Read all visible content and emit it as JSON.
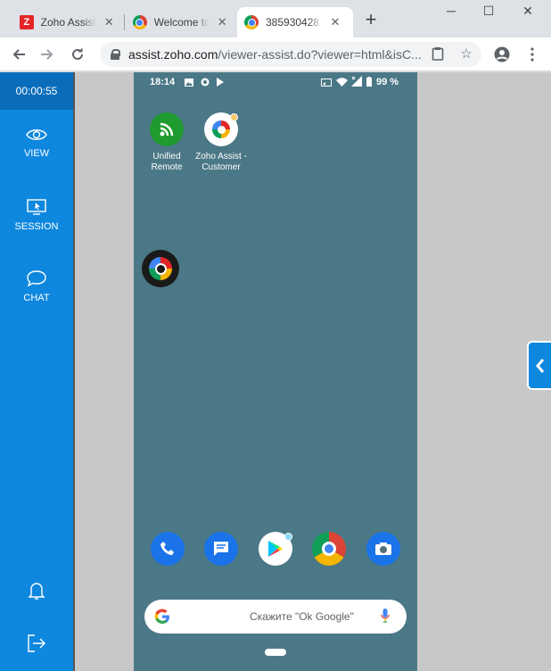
{
  "browser": {
    "tabs": [
      {
        "title": "Zoho Assist",
        "close": "✕"
      },
      {
        "title": "Welcome to",
        "close": "✕"
      },
      {
        "title": "385930428",
        "close": "✕"
      }
    ],
    "new_tab": "+",
    "window": {
      "minimize": "─",
      "maximize": "☐",
      "close": "✕"
    },
    "url": {
      "host": "assist.zoho.com",
      "path": "/viewer-assist.do?viewer=html&isC..."
    }
  },
  "sidebar": {
    "timer": "00:00:55",
    "items": [
      {
        "label": "VIEW",
        "icon": "eye-icon"
      },
      {
        "label": "SESSION",
        "icon": "monitor-cursor-icon"
      },
      {
        "label": "CHAT",
        "icon": "chat-bubble-icon"
      }
    ],
    "bottom": [
      {
        "icon": "bell-icon"
      },
      {
        "icon": "exit-icon"
      }
    ],
    "accent": "#0e87de"
  },
  "phone": {
    "status": {
      "time": "18:14",
      "battery": "99 %"
    },
    "apps": [
      {
        "label": "Unified Remote",
        "line1": "Unified",
        "line2": "Remote"
      },
      {
        "label": "Zoho Assist - Customer",
        "line1": "Zoho Assist -",
        "line2": "Customer"
      }
    ],
    "dock": [
      "phone-app-icon",
      "messages-app-icon",
      "play-store-icon",
      "chrome-app-icon",
      "camera-app-icon"
    ],
    "search_placeholder": "Скажите \"Ok Google\"",
    "wallpaper": "#4b7886"
  }
}
